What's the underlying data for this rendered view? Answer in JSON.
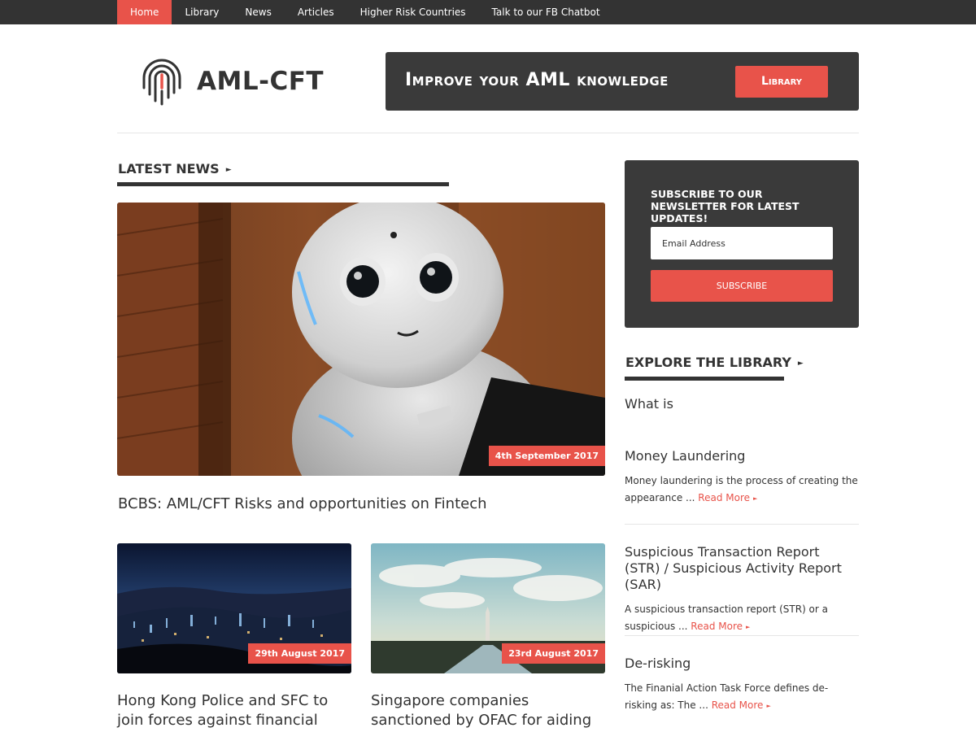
{
  "nav": [
    "Home",
    "Library",
    "News",
    "Articles",
    "Higher Risk Countries",
    "Talk to our FB Chatbot"
  ],
  "brand": "AML-CFT",
  "banner": {
    "text": "Improve your AML knowledge",
    "button": "Library"
  },
  "latest_news": {
    "heading": "LATEST NEWS",
    "featured": {
      "date": "4th September 2017",
      "title": "BCBS: AML/CFT Risks and opportunities on Fintech"
    },
    "items": [
      {
        "date": "29th August 2017",
        "title": "Hong Kong Police and SFC to join forces against financial"
      },
      {
        "date": "23rd August 2017",
        "title": "Singapore companies sanctioned by OFAC for aiding"
      }
    ]
  },
  "newsletter": {
    "title": "SUBSCRIBE TO OUR NEWSLETTER FOR LATEST UPDATES!",
    "placeholder": "Email Address",
    "button": "SUBSCRIBE"
  },
  "library": {
    "heading": "EXPLORE THE LIBRARY",
    "intro": "What is",
    "read_more": "Read More",
    "items": [
      {
        "title": "Money Laundering",
        "desc": "Money laundering is the process of creating the appearance ..."
      },
      {
        "title": "Suspicious Transaction Report (STR) / Suspicious Activity Report (SAR)",
        "desc": "A suspicious transaction report (STR) or a suspicious ..."
      },
      {
        "title": "De-risking",
        "desc": "The Finanial Action Task Force defines de-risking as: The ..."
      }
    ]
  },
  "colors": {
    "accent": "#e8534a",
    "dark": "#333333",
    "panel": "#3a3a3a"
  }
}
